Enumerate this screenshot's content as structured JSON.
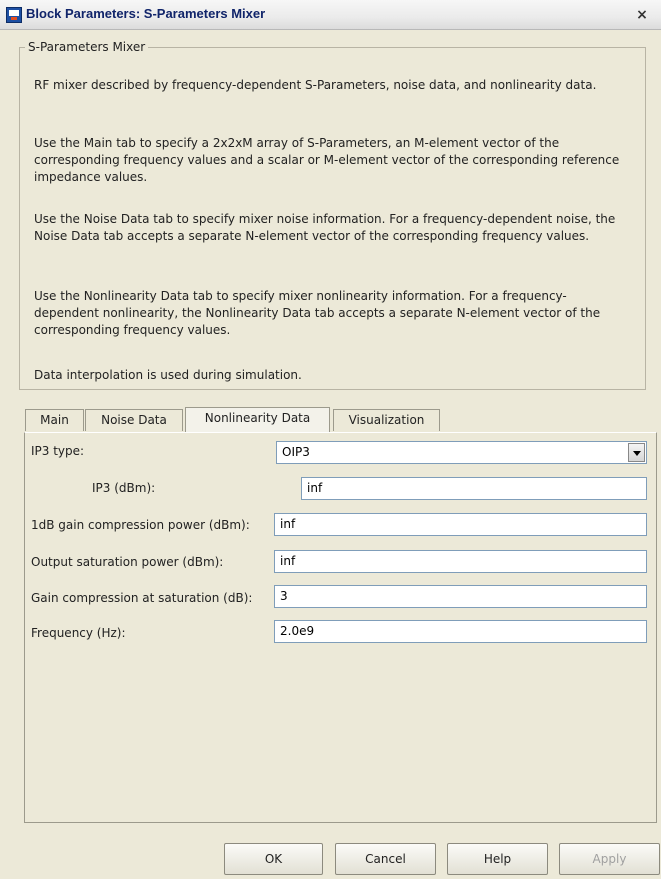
{
  "window": {
    "title": "Block Parameters: S-Parameters Mixer",
    "close_glyph": "×",
    "icon": "simulink-block-icon"
  },
  "group": {
    "legend": "S-Parameters Mixer",
    "paragraphs": [
      "RF mixer described by frequency-dependent S-Parameters, noise data, and nonlinearity data.",
      "Use the Main tab to specify a 2x2xM array of S-Parameters, an M-element vector of the corresponding frequency values and a scalar or M-element vector of the corresponding reference impedance values.",
      "Use the Noise Data tab to specify mixer noise information. For a frequency-dependent noise, the Noise Data tab accepts a separate N-element vector of the corresponding frequency values.",
      "Use the Nonlinearity Data tab to specify mixer nonlinearity information. For a frequency-dependent nonlinearity, the Nonlinearity Data tab accepts a separate N-element vector of the corresponding frequency values.",
      "Data interpolation is used during simulation."
    ]
  },
  "tabs": [
    {
      "label": "Main",
      "active": false
    },
    {
      "label": "Noise Data",
      "active": false
    },
    {
      "label": "Nonlinearity Data",
      "active": true
    },
    {
      "label": "Visualization",
      "active": false
    }
  ],
  "params": {
    "ip3_type": {
      "label": "IP3 type:",
      "value": "OIP3"
    },
    "ip3": {
      "label": "IP3 (dBm):",
      "value": "inf"
    },
    "p1db": {
      "label": "1dB gain compression power (dBm):",
      "value": "inf"
    },
    "psat": {
      "label": "Output saturation power (dBm):",
      "value": "inf"
    },
    "gcsat": {
      "label": "Gain compression at saturation (dB):",
      "value": "3"
    },
    "freq": {
      "label": "Frequency (Hz):",
      "value": "2.0e9"
    }
  },
  "buttons": {
    "ok": "OK",
    "cancel": "Cancel",
    "help": "Help",
    "apply": "Apply"
  }
}
